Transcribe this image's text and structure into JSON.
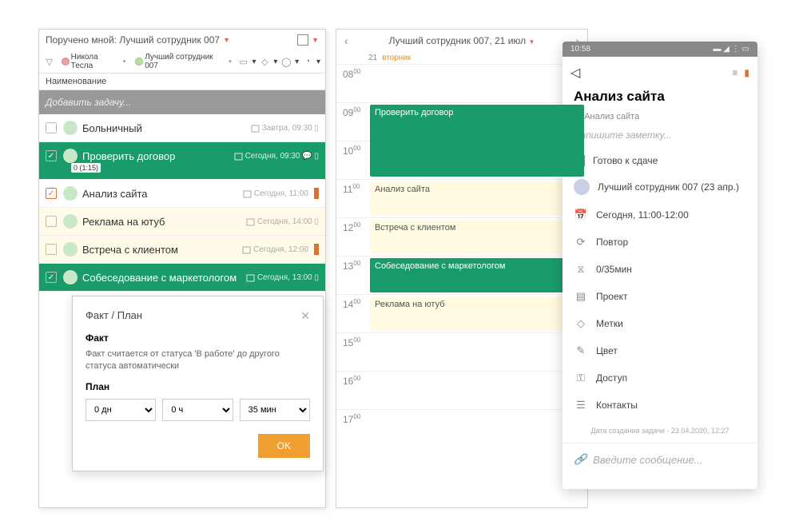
{
  "left": {
    "title": "Поручено мной: Лучший сотрудник 007",
    "chip1": "Никола Тесла",
    "chip2": "Лучший сотрудник 007",
    "colhead": "Наименование",
    "addtask": "Добавить задачу...",
    "rows": [
      {
        "title": "Больничный",
        "meta": "Завтра, 09:30",
        "variant": "plain",
        "checked": false
      },
      {
        "title": "Проверить договор",
        "meta": "Сегодня, 09:30",
        "variant": "sel",
        "checked": true,
        "badge": "0 (1:15)",
        "chat": true
      },
      {
        "title": "Анализ сайта",
        "meta": "Сегодня, 11:00",
        "variant": "plain",
        "checked": true,
        "checkred": true,
        "bookmark": true
      },
      {
        "title": "Реклама на ютуб",
        "meta": "Сегодня, 14:00",
        "variant": "yellow",
        "checked": false
      },
      {
        "title": "Встреча с клиентом",
        "meta": "Сегодня, 12:00",
        "variant": "yellow",
        "checked": false,
        "bookmark": true
      },
      {
        "title": "Собеседование с маркетологом",
        "meta": "Сегодня, 13:00",
        "variant": "sel",
        "checked": true
      }
    ]
  },
  "popup": {
    "title": "Факт / План",
    "fact_h": "Факт",
    "fact_p": "Факт считается от статуса 'В работе' до другого статуса автоматически",
    "plan_h": "План",
    "d": "0 дн",
    "h": "0 ч",
    "m": "35 мин",
    "ok": "OK"
  },
  "mid": {
    "title": "Лучший сотрудник 007, 21 июл",
    "daynum": "21",
    "dayname": "вторник",
    "hours": [
      "08",
      "09",
      "10",
      "11",
      "12",
      "13",
      "14",
      "15",
      "16",
      "17"
    ],
    "events": {
      "09": {
        "t": "Проверить договор",
        "c": "green"
      },
      "11": {
        "t": "Анализ сайта",
        "c": "yellow"
      },
      "12": {
        "t": "Встреча с клиентом",
        "c": "yellow"
      },
      "13": {
        "t": "Собеседование с маркетологом",
        "c": "green"
      },
      "14": {
        "t": "Реклама на ютуб",
        "c": "yellow"
      }
    }
  },
  "right": {
    "time": "10:58",
    "title": "Анализ сайта",
    "sub": "Анализ сайта",
    "note": "Напишите заметку...",
    "items": [
      {
        "ic": "check",
        "t": "Готово к сдаче"
      },
      {
        "ic": "avatar",
        "t": "Лучший сотрудник 007 (23 апр.)"
      },
      {
        "ic": "cal",
        "t": "Сегодня, 11:00-12:00"
      },
      {
        "ic": "repeat",
        "t": "Повтор"
      },
      {
        "ic": "hour",
        "t": "0/35мин"
      },
      {
        "ic": "proj",
        "t": "Проект"
      },
      {
        "ic": "tag",
        "t": "Метки"
      },
      {
        "ic": "color",
        "t": "Цвет"
      },
      {
        "ic": "access",
        "t": "Доступ"
      },
      {
        "ic": "contact",
        "t": "Контакты"
      }
    ],
    "created": "Дата создания задачи - 23.04.2020, 12:27",
    "msg": "Введите сообщение..."
  }
}
